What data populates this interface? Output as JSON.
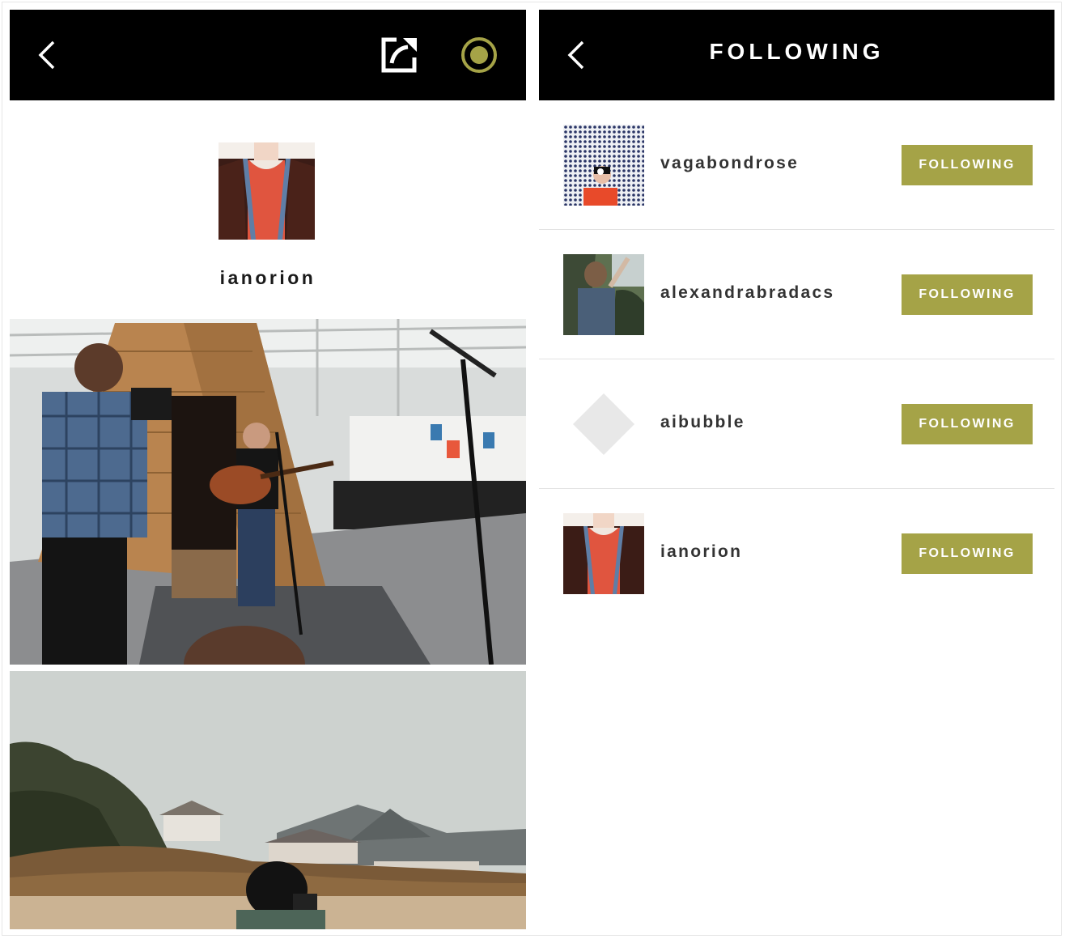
{
  "colors": {
    "topbar": "#000000",
    "accent": "#a5a347",
    "divider": "#e3e3e3",
    "text": "#333333"
  },
  "profile_screen": {
    "icons": [
      "chevron-left-icon",
      "share-icon",
      "record-icon"
    ],
    "username": "ianorion",
    "photos": [
      {
        "description_icon": "photo-concert-in-office"
      },
      {
        "description_icon": "photo-beach-landscape"
      }
    ]
  },
  "following_screen": {
    "title": "FOLLOWING",
    "icons": [
      "chevron-left-icon"
    ],
    "items": [
      {
        "username": "vagabondrose",
        "button_label": "FOLLOWING",
        "avatar": "halftone-portrait"
      },
      {
        "username": "alexandrabradacs",
        "button_label": "FOLLOWING",
        "avatar": "forest-portrait"
      },
      {
        "username": "aibubble",
        "button_label": "FOLLOWING",
        "avatar": "default-diamond"
      },
      {
        "username": "ianorion",
        "button_label": "FOLLOWING",
        "avatar": "jacket-portrait"
      }
    ]
  }
}
